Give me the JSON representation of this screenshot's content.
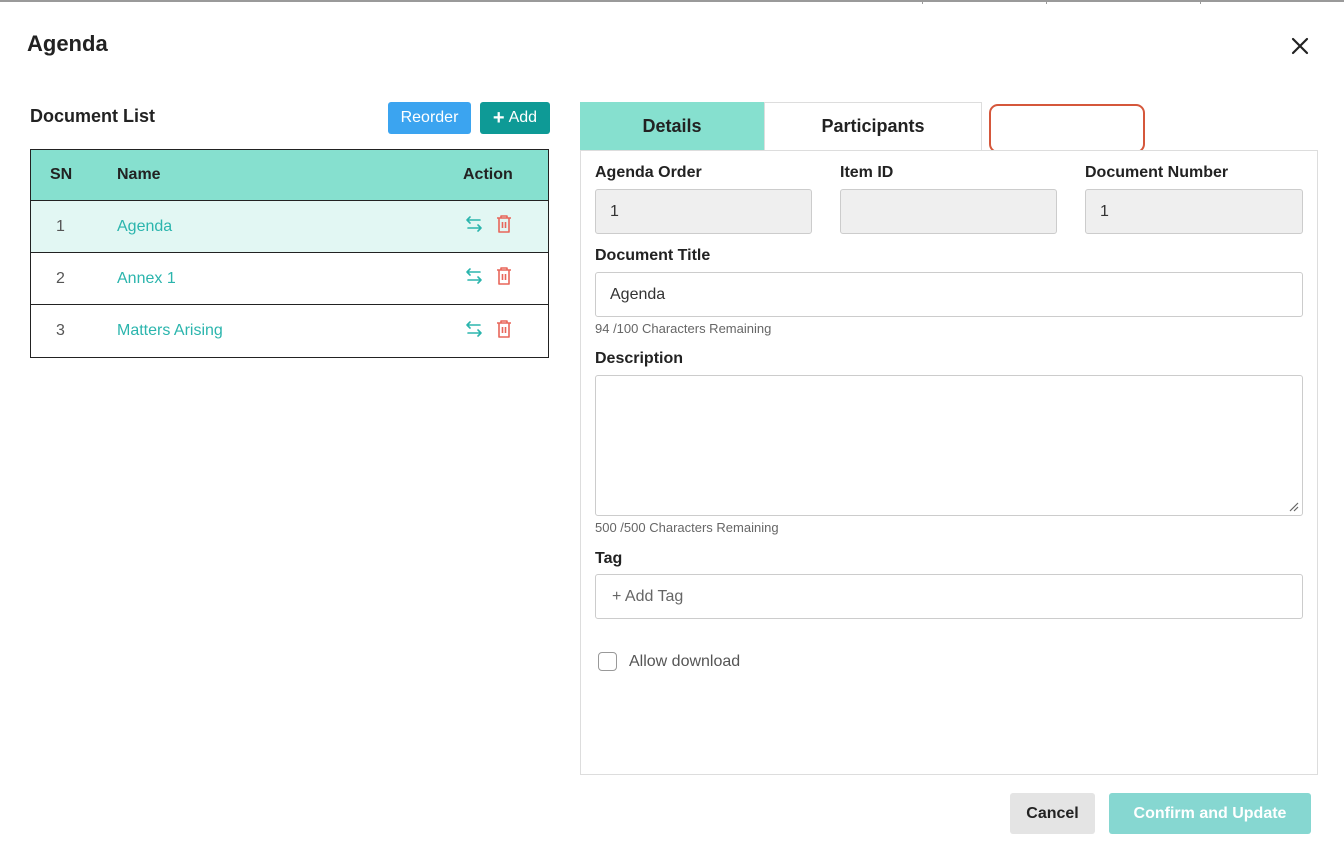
{
  "modal": {
    "title": "Agenda"
  },
  "document_list": {
    "title": "Document List",
    "reorder_label": "Reorder",
    "add_label": "Add",
    "columns": {
      "sn": "SN",
      "name": "Name",
      "action": "Action"
    },
    "rows": [
      {
        "sn": "1",
        "name": "Agenda",
        "selected": true
      },
      {
        "sn": "2",
        "name": "Annex 1",
        "selected": false
      },
      {
        "sn": "3",
        "name": "Matters Arising",
        "selected": false
      }
    ],
    "icons": {
      "reorder": "swap-arrows-icon",
      "delete": "trash-icon"
    }
  },
  "tabs": [
    {
      "label": "Details",
      "active": true
    },
    {
      "label": "Participants",
      "active": false
    }
  ],
  "details": {
    "agenda_order": {
      "label": "Agenda Order",
      "value": "1"
    },
    "item_id": {
      "label": "Item ID",
      "value": ""
    },
    "document_number": {
      "label": "Document Number",
      "value": "1"
    },
    "document_title": {
      "label": "Document Title",
      "value": "Agenda",
      "hint": "94 /100 Characters Remaining"
    },
    "description": {
      "label": "Description",
      "value": "",
      "hint": "500 /500 Characters Remaining"
    },
    "tag": {
      "label": "Tag",
      "placeholder": "+ Add Tag"
    },
    "allow_download": {
      "label": "Allow download",
      "checked": false
    }
  },
  "footer": {
    "cancel_label": "Cancel",
    "confirm_label": "Confirm and Update"
  },
  "colors": {
    "teal_header": "#86e0cf",
    "selected_row": "#e2f7f3",
    "link_teal": "#2bb5ad",
    "reorder_blue": "#3ba4f0",
    "add_teal": "#0e9a96",
    "delete_red": "#e8665a",
    "highlight_outline": "#d5573b",
    "confirm_disabled": "#86d7d1"
  }
}
